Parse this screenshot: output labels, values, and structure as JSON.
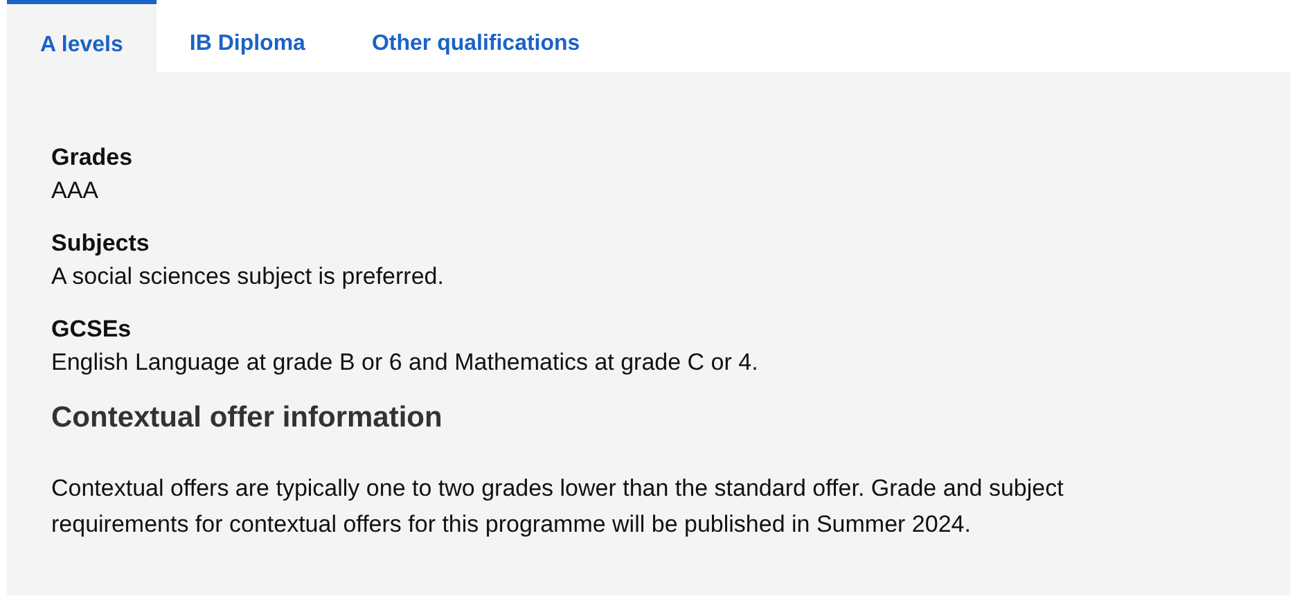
{
  "tabs": [
    {
      "label": "A levels",
      "selected": true
    },
    {
      "label": "IB Diploma",
      "selected": false
    },
    {
      "label": "Other qualifications",
      "selected": false
    }
  ],
  "requirements": [
    {
      "heading": "Grades",
      "text": "AAA"
    },
    {
      "heading": "Subjects",
      "text": "A social sciences subject is preferred."
    },
    {
      "heading": "GCSEs",
      "text": "English Language at grade B or 6 and Mathematics at grade C or 4."
    }
  ],
  "contextual": {
    "title": "Contextual offer information",
    "text": "Contextual offers are typically one to two grades lower than the standard offer. Grade and subject requirements for contextual offers for this programme will be published in Summer 2024."
  }
}
